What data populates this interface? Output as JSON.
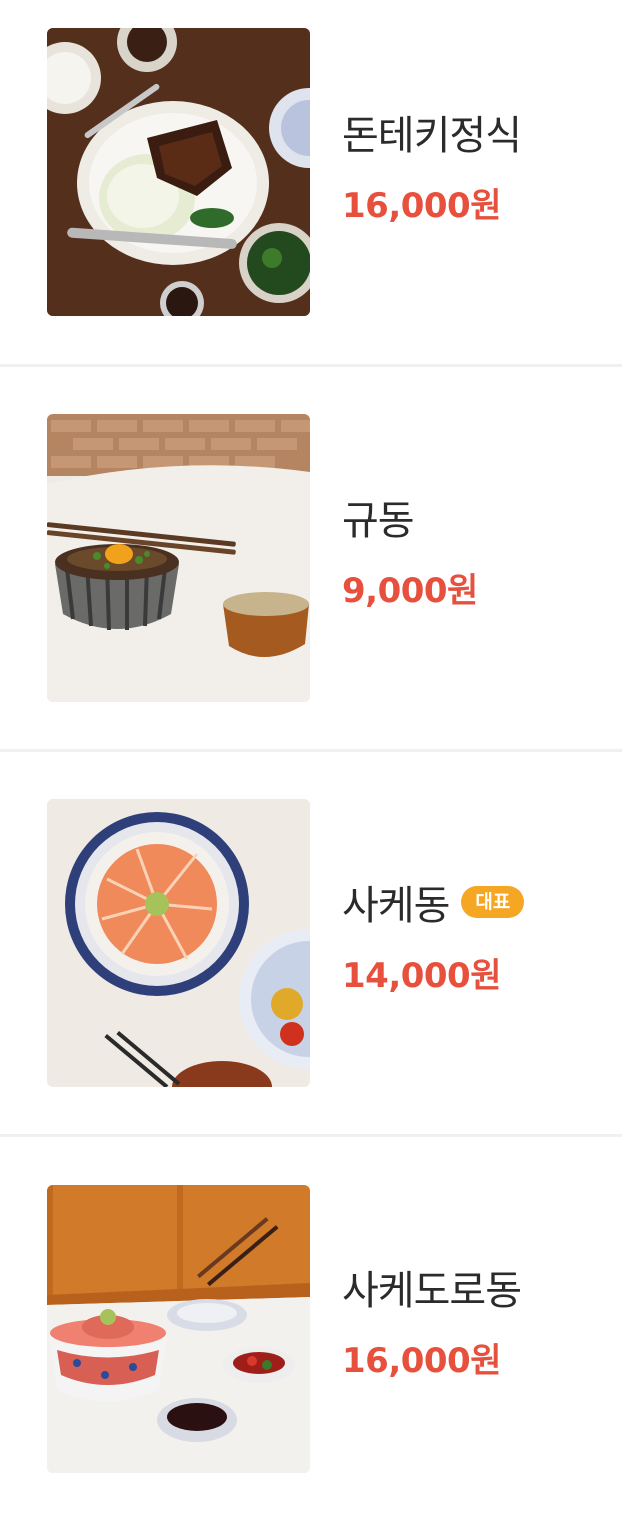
{
  "menu": {
    "items": [
      {
        "name": "돈테키정식",
        "price": "16,000원",
        "image_alt": "tonteki-set-photo"
      },
      {
        "name": "규동",
        "price": "9,000원",
        "image_alt": "gyudon-photo"
      },
      {
        "name": "사케동",
        "price": "14,000원",
        "badge": "대표",
        "image_alt": "sakedon-photo"
      },
      {
        "name": "사케도로동",
        "price": "16,000원",
        "image_alt": "sakedorodon-photo"
      }
    ]
  },
  "colors": {
    "name_text": "#2b2b2b",
    "price_text": "#e6503d",
    "badge_bg": "#f5a623",
    "divider": "#f0f0f0"
  }
}
